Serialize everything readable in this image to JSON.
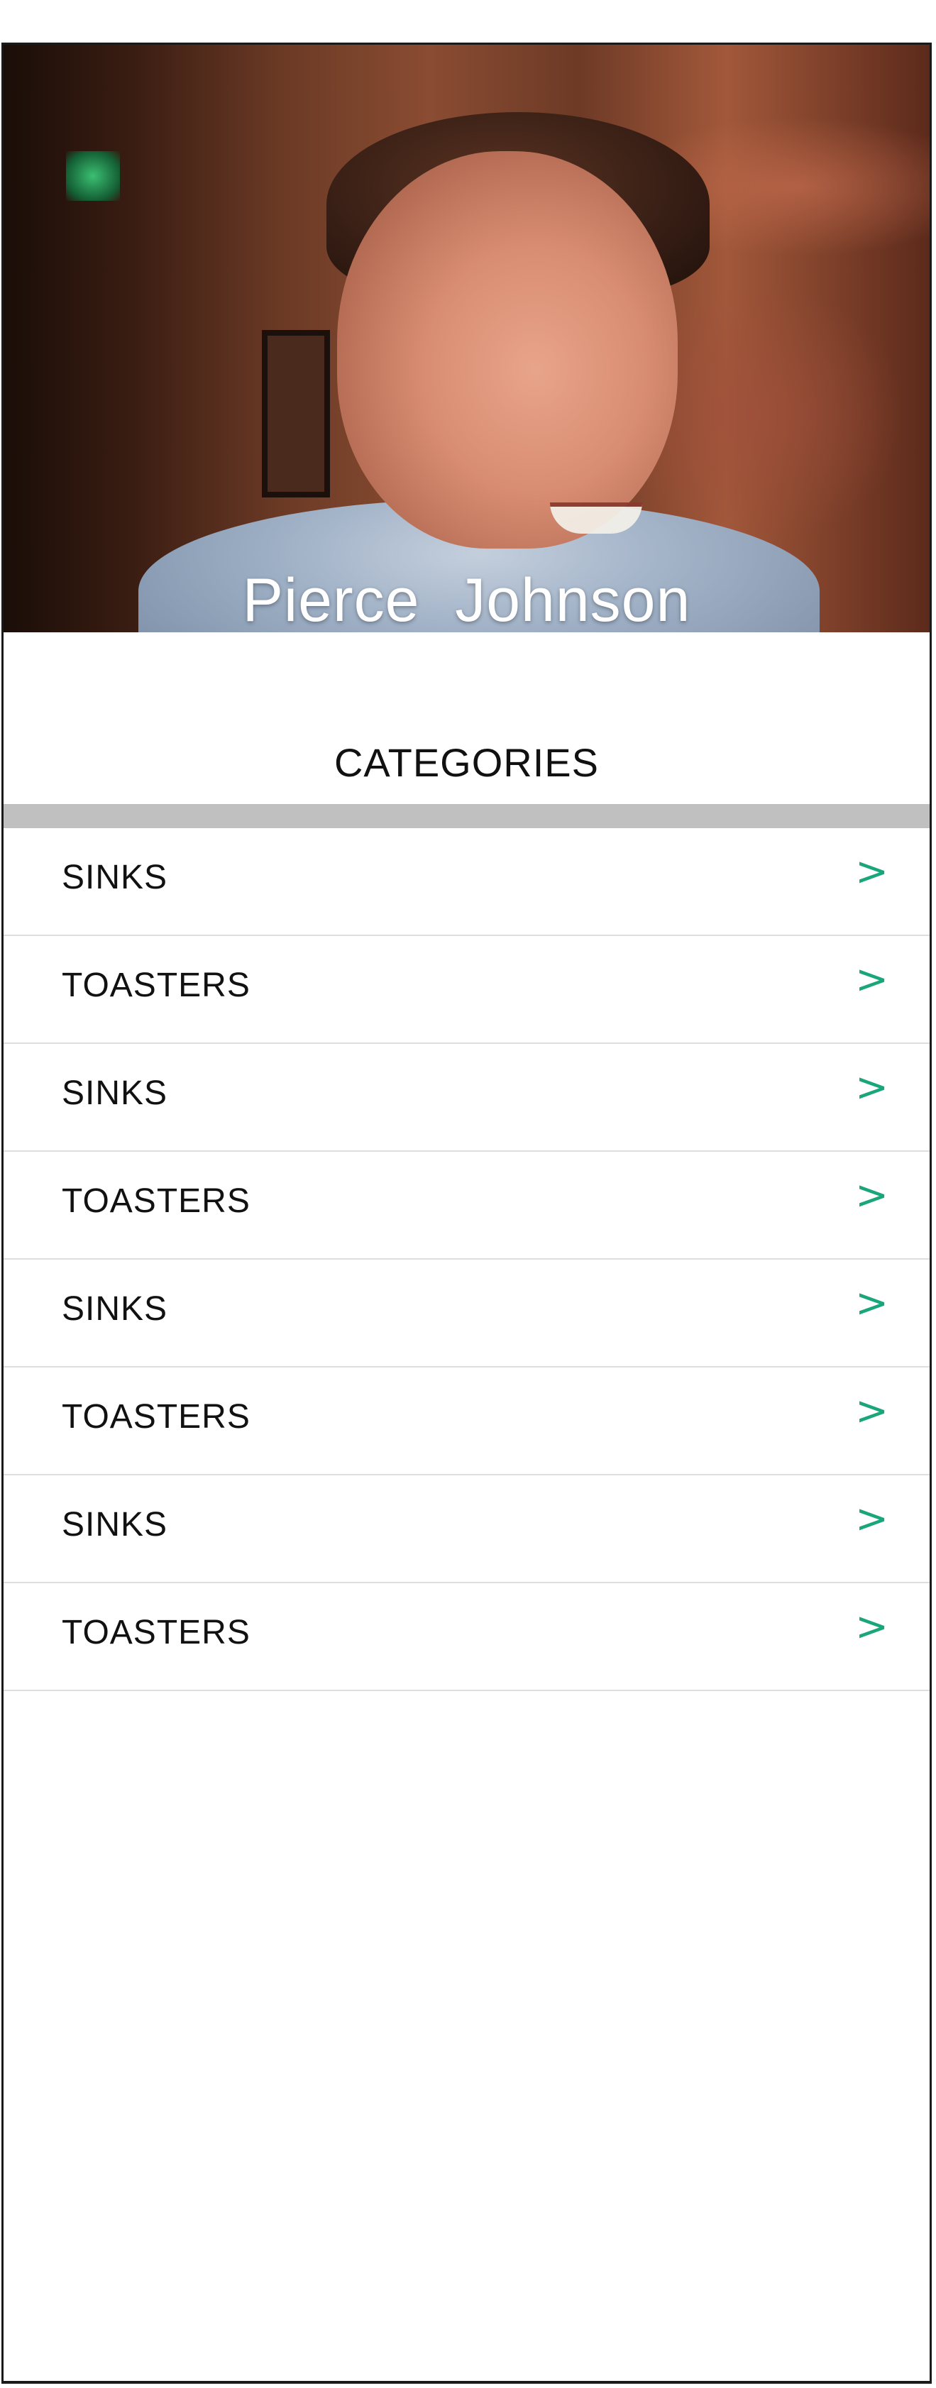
{
  "profile": {
    "name": "Pierce  Johnson"
  },
  "section": {
    "title": "CATEGORIES"
  },
  "categories": {
    "items": [
      {
        "label": "SINKS",
        "icon": "chevron-right-icon"
      },
      {
        "label": "TOASTERS",
        "icon": "chevron-right-icon"
      },
      {
        "label": "SINKS",
        "icon": "chevron-right-icon"
      },
      {
        "label": "TOASTERS",
        "icon": "chevron-right-icon"
      },
      {
        "label": "SINKS",
        "icon": "chevron-right-icon"
      },
      {
        "label": "TOASTERS",
        "icon": "chevron-right-icon"
      },
      {
        "label": "SINKS",
        "icon": "chevron-right-icon"
      },
      {
        "label": "TOASTERS",
        "icon": "chevron-right-icon"
      }
    ],
    "chevron_glyph": ">"
  },
  "colors": {
    "accent": "#1aa57a",
    "divider": "#c0c0c0",
    "text": "#111111"
  }
}
